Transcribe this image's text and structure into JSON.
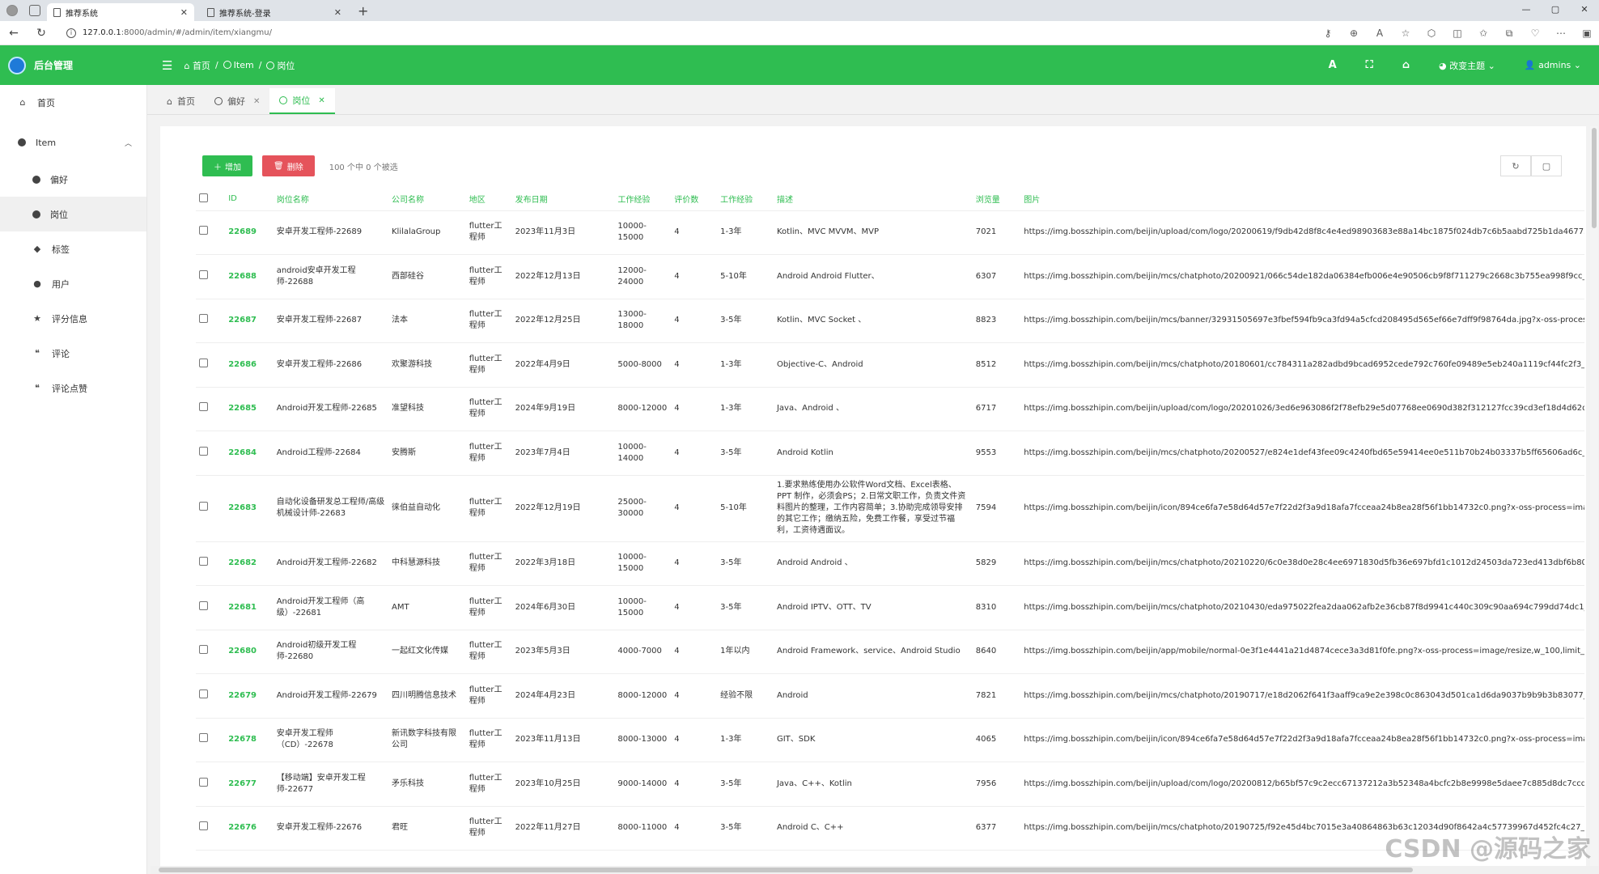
{
  "browser": {
    "tabs": [
      {
        "title": "推荐系统",
        "active": true
      },
      {
        "title": "推荐系统-登录",
        "active": false
      }
    ],
    "url_host": "127.0.0.1",
    "url_path": ":8000/admin/#/admin/item/xiangmu/",
    "window_controls": [
      "—",
      "▢",
      "✕"
    ]
  },
  "header": {
    "app_title": "后台管理",
    "breadcrumb": [
      "首页",
      "Item",
      "岗位"
    ],
    "theme_label": "改变主题",
    "user_label": "admins",
    "font_icon": "A"
  },
  "sidebar": {
    "home": "首页",
    "item_group": "Item",
    "children": [
      "偏好",
      "岗位"
    ],
    "others": [
      "标签",
      "用户",
      "评分信息",
      "评论",
      "评论点赞"
    ]
  },
  "page_tabs": [
    {
      "label": "首页",
      "active": false,
      "closable": false
    },
    {
      "label": "偏好",
      "active": false,
      "closable": true
    },
    {
      "label": "岗位",
      "active": true,
      "closable": true
    }
  ],
  "toolbar": {
    "add_label": "增加",
    "delete_label": "删除",
    "selection_info": "100 个中 0 个被选"
  },
  "table": {
    "columns": [
      "ID",
      "岗位名称",
      "公司名称",
      "地区",
      "发布日期",
      "工作经验",
      "评价数",
      "工作经验",
      "描述",
      "浏览量",
      "图片",
      "图片"
    ],
    "rows": [
      {
        "id": "22689",
        "name": "安卓开发工程师-22689",
        "company": "KlilalaGroup",
        "region": "flutter工程师",
        "date": "2023年11月3日",
        "salary": "10000-15000",
        "count": "4",
        "exp": "1-3年",
        "desc": "Kotlin、MVC MVVM、MVP",
        "views": "7021",
        "img": "https://img.bosszhipin.com/beijin/upload/com/logo/20200619/f9db42d8f8c4e4ed98903683e88a14bc1875f024db7c6b5aabd725b1da46773e.jpg?x-oss-process=image/resize,w_100,limit_0",
        "img2": "picture/2268"
      },
      {
        "id": "22688",
        "name": "android安卓开发工程师-22688",
        "company": "西部硅谷",
        "region": "flutter工程师",
        "date": "2022年12月13日",
        "salary": "12000-24000",
        "count": "4",
        "exp": "5-10年",
        "desc": "Android Android Flutter、",
        "views": "6307",
        "img": "https://img.bosszhipin.com/beijin/mcs/chatphoto/20200921/066c54de182da06384efb006e4e90506cb9f8f711279c2668c3b755ea998f9cc_s.jpg?x-oss-process=image/resize,w_100,limit_0",
        "img2": "picture/2268"
      },
      {
        "id": "22687",
        "name": "安卓开发工程师-22687",
        "company": "法本",
        "region": "flutter工程师",
        "date": "2022年12月25日",
        "salary": "13000-18000",
        "count": "4",
        "exp": "3-5年",
        "desc": "Kotlin、MVC Socket 、",
        "views": "8823",
        "img": "https://img.bosszhipin.com/beijin/mcs/banner/32931505697e3fbef594fb9ca3fd94a5cfcd208495d565ef66e7dff9f98764da.jpg?x-oss-process=image/resize,w_100,limit_0",
        "img2": "picture/2268"
      },
      {
        "id": "22686",
        "name": "安卓开发工程师-22686",
        "company": "欢聚游科技",
        "region": "flutter工程师",
        "date": "2022年4月9日",
        "salary": "5000-8000",
        "count": "4",
        "exp": "1-3年",
        "desc": "Objective-C、Android",
        "views": "8512",
        "img": "https://img.bosszhipin.com/beijin/mcs/chatphoto/20180601/cc784311a282adbd9bcad6952cede792c760fe09489e5eb240a1119cf44fc2f3_s.jpg?x-oss-process=image/resize,w_100,limit_0",
        "img2": "picture/2268"
      },
      {
        "id": "22685",
        "name": "Android开发工程师-22685",
        "company": "准望科技",
        "region": "flutter工程师",
        "date": "2024年9月19日",
        "salary": "8000-12000",
        "count": "4",
        "exp": "1-3年",
        "desc": "Java、Android 、",
        "views": "6717",
        "img": "https://img.bosszhipin.com/beijin/upload/com/logo/20201026/3ed6e963086f2f78efb29e5d07768ee0690d382f312127fcc39cd3ef18d4d62d.png?x-oss-process=image/resize,w_100,limit_0",
        "img2": "picture/2268"
      },
      {
        "id": "22684",
        "name": "Android工程师-22684",
        "company": "安腾斯",
        "region": "flutter工程师",
        "date": "2023年7月4日",
        "salary": "10000-14000",
        "count": "4",
        "exp": "3-5年",
        "desc": "Android Kotlin",
        "views": "9553",
        "img": "https://img.bosszhipin.com/beijin/mcs/chatphoto/20200527/e824e1def43fee09c4240fbd65e59414ee0e511b70b24b03337b5ff65606ad6c_s.jpg?x-oss-process=image/resize,w_100,limit_0",
        "img2": "picture/2268"
      },
      {
        "id": "22683",
        "name": "自动化设备研发总工程师/高级机械设计师-22683",
        "company": "徕伯益自动化",
        "region": "flutter工程师",
        "date": "2022年12月19日",
        "salary": "25000-30000",
        "count": "4",
        "exp": "5-10年",
        "desc": "1.要求熟练使用办公软件Word文档、Excel表格、 PPT 制作，必须会PS；2.日常文职工作，负责文件资料图片的整理，工作内容简单；3.协助完成领导安排的其它工作；缴纳五险，免费工作餐，享受过节福利，工资待遇面议。",
        "views": "7594",
        "img": "https://img.bosszhipin.com/beijin/icon/894ce6fa7e58d64d57e7f22d2f3a9d18afa7fcceaa24b8ea28f56f1bb14732c0.png?x-oss-process=image/resize,w_100,limit_0",
        "img2": "picture/2268",
        "tall": true
      },
      {
        "id": "22682",
        "name": "Android开发工程师-22682",
        "company": "中科慧源科技",
        "region": "flutter工程师",
        "date": "2022年3月18日",
        "salary": "10000-15000",
        "count": "4",
        "exp": "3-5年",
        "desc": "Android Android 、",
        "views": "5829",
        "img": "https://img.bosszhipin.com/beijin/mcs/chatphoto/20210220/6c0e38d0e28c4ee6971830d5fb36e697bfd1c1012d24503da723ed413dbf6b80_s.jpg?x-oss-process=image/resize,w_100,limit_0",
        "img2": "picture/2268"
      },
      {
        "id": "22681",
        "name": "Android开发工程师（高级）-22681",
        "company": "AMT",
        "region": "flutter工程师",
        "date": "2024年6月30日",
        "salary": "10000-15000",
        "count": "4",
        "exp": "3-5年",
        "desc": "Android IPTV、OTT、TV",
        "views": "8310",
        "img": "https://img.bosszhipin.com/beijin/mcs/chatphoto/20210430/eda975022fea2daa062afb2e36cb87f8d9941c440c309c90aa694c799dd74dc1_s.jpg?x-oss-process=image/resize,w_100,limit_0",
        "img2": "picture/2268"
      },
      {
        "id": "22680",
        "name": "Android初级开发工程师-22680",
        "company": "一起红文化传媒",
        "region": "flutter工程师",
        "date": "2023年5月3日",
        "salary": "4000-7000",
        "count": "4",
        "exp": "1年以内",
        "desc": "Android Framework、service、Android Studio",
        "views": "8640",
        "img": "https://img.bosszhipin.com/beijin/app/mobile/normal-0e3f1e4441a21d4874cece3a3d81f0fe.png?x-oss-process=image/resize,w_100,limit_0",
        "img2": "picture/2268"
      },
      {
        "id": "22679",
        "name": "Android开发工程师-22679",
        "company": "四川明腾信息技术",
        "region": "flutter工程师",
        "date": "2024年4月23日",
        "salary": "8000-12000",
        "count": "4",
        "exp": "经验不限",
        "desc": "Android",
        "views": "7821",
        "img": "https://img.bosszhipin.com/beijin/mcs/chatphoto/20190717/e18d2062f641f3aaff9ca9e2e398c0c863043d501ca1d6da9037b9b9b3b83077_s.jpg?x-oss-process=image/resize,w_100,limit_0",
        "img2": "picture/2268"
      },
      {
        "id": "22678",
        "name": "安卓开发工程师（CD）-22678",
        "company": "新讯数字科技有限公司",
        "region": "flutter工程师",
        "date": "2023年11月13日",
        "salary": "8000-13000",
        "count": "4",
        "exp": "1-3年",
        "desc": "GIT、SDK",
        "views": "4065",
        "img": "https://img.bosszhipin.com/beijin/icon/894ce6fa7e58d64d57e7f22d2f3a9d18afa7fcceaa24b8ea28f56f1bb14732c0.png?x-oss-process=image/resize,w_100,limit_0",
        "img2": "picture/2268"
      },
      {
        "id": "22677",
        "name": "【移动端】安卓开发工程师-22677",
        "company": "矛乐科技",
        "region": "flutter工程师",
        "date": "2023年10月25日",
        "salary": "9000-14000",
        "count": "4",
        "exp": "3-5年",
        "desc": "Java、C++、Kotlin",
        "views": "7956",
        "img": "https://img.bosszhipin.com/beijin/upload/com/logo/20200812/b65bf57c9c2ecc67137212a3b52348a4bcfc2b8e9998e5daee7c885d8dc7ccd4.jpg?x-oss-process=image/resize,w_100,limit_0",
        "img2": "picture/2268"
      },
      {
        "id": "22676",
        "name": "安卓开发工程师-22676",
        "company": "君旺",
        "region": "flutter工程师",
        "date": "2022年11月27日",
        "salary": "8000-11000",
        "count": "4",
        "exp": "3-5年",
        "desc": "Android C、C++",
        "views": "6377",
        "img": "https://img.bosszhipin.com/beijin/mcs/chatphoto/20190725/f92e45d4bc7015e3a40864863b63c12034d90f8642a4c57739967d452fc4c27_s.jpg?x-oss-process=image/resize,w_100,limit_0",
        "img2": "picture/2268"
      }
    ]
  },
  "watermark": "CSDN @源码之家",
  "colors": {
    "accent": "#2fbd51",
    "danger": "#e5535b"
  }
}
